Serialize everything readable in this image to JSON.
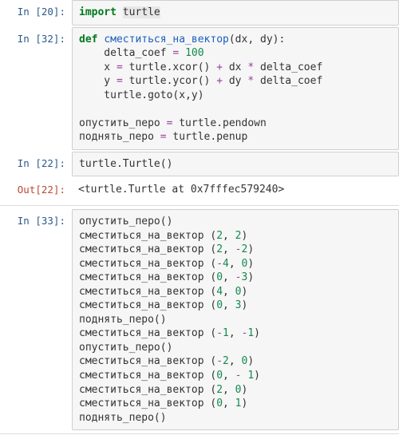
{
  "cells": [
    {
      "prompt": "In [20]:",
      "type": "in",
      "tokens": [
        {
          "t": "import ",
          "c": "kw"
        },
        {
          "t": "turtle",
          "c": "sel"
        }
      ]
    },
    {
      "prompt": "In [32]:",
      "type": "in",
      "tokens": [
        {
          "t": "def ",
          "c": "kw"
        },
        {
          "t": "сместиться_на_вектор",
          "c": "fn"
        },
        {
          "t": "(dx, dy):\n"
        },
        {
          "t": "    delta_coef "
        },
        {
          "t": "= ",
          "c": "op"
        },
        {
          "t": "100",
          "c": "num"
        },
        {
          "t": "\n"
        },
        {
          "t": "    x "
        },
        {
          "t": "= ",
          "c": "op"
        },
        {
          "t": "turtle.xcor() "
        },
        {
          "t": "+ ",
          "c": "op"
        },
        {
          "t": "dx "
        },
        {
          "t": "* ",
          "c": "op"
        },
        {
          "t": "delta_coef\n"
        },
        {
          "t": "    y "
        },
        {
          "t": "= ",
          "c": "op"
        },
        {
          "t": "turtle.ycor() "
        },
        {
          "t": "+ ",
          "c": "op"
        },
        {
          "t": "dy "
        },
        {
          "t": "* ",
          "c": "op"
        },
        {
          "t": "delta_coef\n"
        },
        {
          "t": "    turtle.goto(x,y)\n"
        },
        {
          "t": "\n"
        },
        {
          "t": "опустить_перо "
        },
        {
          "t": "= ",
          "c": "op"
        },
        {
          "t": "turtle.pendown\n"
        },
        {
          "t": "поднять_перо "
        },
        {
          "t": "= ",
          "c": "op"
        },
        {
          "t": "turtle.penup"
        }
      ]
    },
    {
      "prompt": "In [22]:",
      "type": "in",
      "tokens": [
        {
          "t": "turtle.Turtle()"
        }
      ]
    },
    {
      "prompt": "Out[22]:",
      "type": "out",
      "plain": "<turtle.Turtle at 0x7fffec579240>"
    },
    {
      "prompt": "In [33]:",
      "type": "in",
      "tokens": [
        {
          "t": "опустить_перо()\n"
        },
        {
          "t": "сместиться_на_вектор ("
        },
        {
          "t": "2",
          "c": "num"
        },
        {
          "t": ", "
        },
        {
          "t": "2",
          "c": "num"
        },
        {
          "t": ")\n"
        },
        {
          "t": "сместиться_на_вектор ("
        },
        {
          "t": "2",
          "c": "num"
        },
        {
          "t": ", "
        },
        {
          "t": "-",
          "c": "op"
        },
        {
          "t": "2",
          "c": "num"
        },
        {
          "t": ")\n"
        },
        {
          "t": "сместиться_на_вектор ("
        },
        {
          "t": "-",
          "c": "op"
        },
        {
          "t": "4",
          "c": "num"
        },
        {
          "t": ", "
        },
        {
          "t": "0",
          "c": "num"
        },
        {
          "t": ")\n"
        },
        {
          "t": "сместиться_на_вектор ("
        },
        {
          "t": "0",
          "c": "num"
        },
        {
          "t": ", "
        },
        {
          "t": "-",
          "c": "op"
        },
        {
          "t": "3",
          "c": "num"
        },
        {
          "t": ")\n"
        },
        {
          "t": "сместиться_на_вектор ("
        },
        {
          "t": "4",
          "c": "num"
        },
        {
          "t": ", "
        },
        {
          "t": "0",
          "c": "num"
        },
        {
          "t": ")\n"
        },
        {
          "t": "сместиться_на_вектор ("
        },
        {
          "t": "0",
          "c": "num"
        },
        {
          "t": ", "
        },
        {
          "t": "3",
          "c": "num"
        },
        {
          "t": ")\n"
        },
        {
          "t": "поднять_перо()\n"
        },
        {
          "t": "сместиться_на_вектор ("
        },
        {
          "t": "-",
          "c": "op"
        },
        {
          "t": "1",
          "c": "num"
        },
        {
          "t": ", "
        },
        {
          "t": "-",
          "c": "op"
        },
        {
          "t": "1",
          "c": "num"
        },
        {
          "t": ")\n"
        },
        {
          "t": "опустить_перо()\n"
        },
        {
          "t": "сместиться_на_вектор ("
        },
        {
          "t": "-",
          "c": "op"
        },
        {
          "t": "2",
          "c": "num"
        },
        {
          "t": ", "
        },
        {
          "t": "0",
          "c": "num"
        },
        {
          "t": ")\n"
        },
        {
          "t": "сместиться_на_вектор ("
        },
        {
          "t": "0",
          "c": "num"
        },
        {
          "t": ", "
        },
        {
          "t": "- ",
          "c": "op"
        },
        {
          "t": "1",
          "c": "num"
        },
        {
          "t": ")\n"
        },
        {
          "t": "сместиться_на_вектор ("
        },
        {
          "t": "2",
          "c": "num"
        },
        {
          "t": ", "
        },
        {
          "t": "0",
          "c": "num"
        },
        {
          "t": ")\n"
        },
        {
          "t": "сместиться_на_вектор ("
        },
        {
          "t": "0",
          "c": "num"
        },
        {
          "t": ", "
        },
        {
          "t": "1",
          "c": "num"
        },
        {
          "t": ")\n"
        },
        {
          "t": "поднять_перо()"
        }
      ]
    }
  ]
}
